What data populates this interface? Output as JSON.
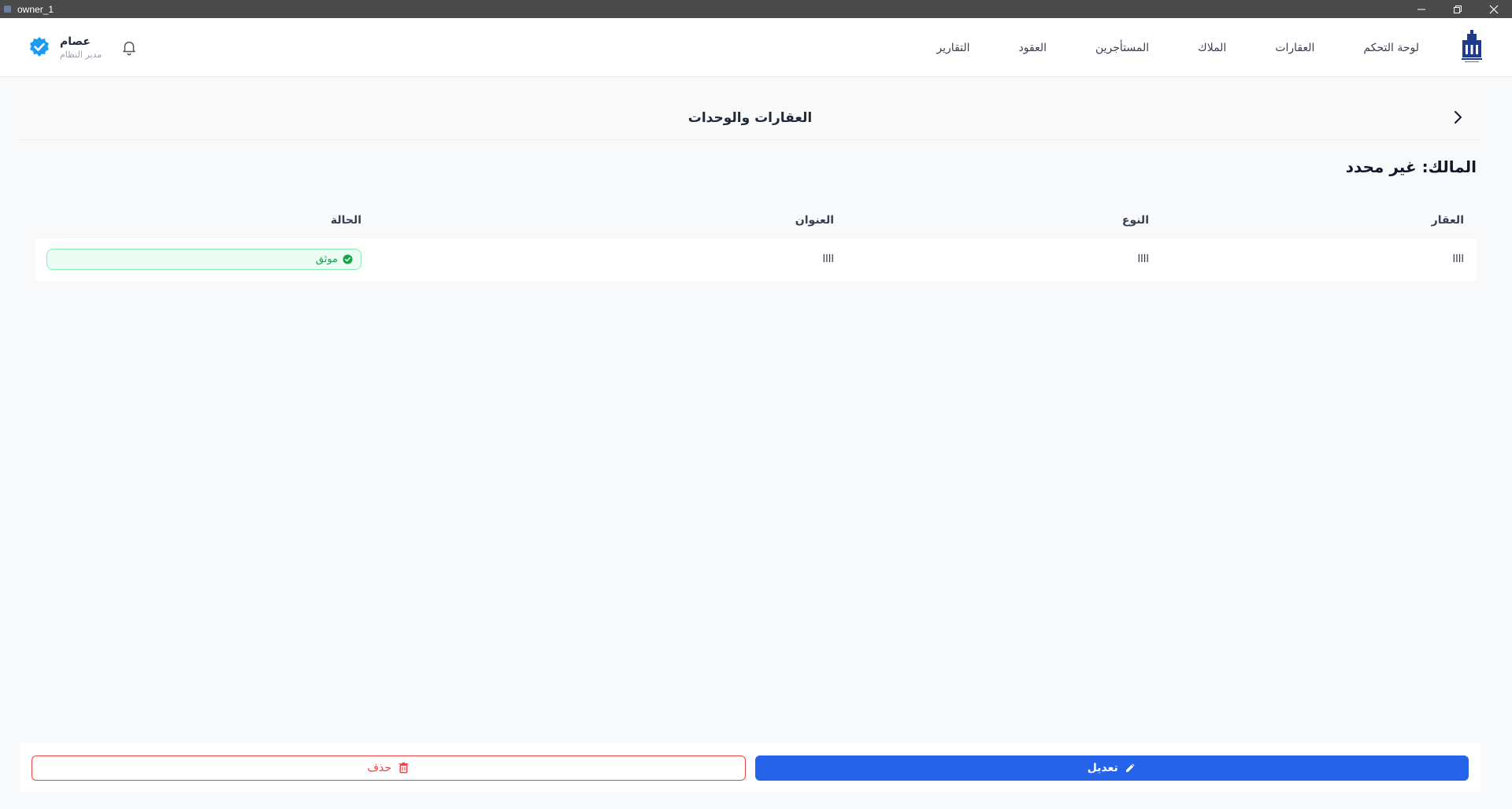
{
  "window": {
    "title": "owner_1"
  },
  "nav": {
    "items": [
      {
        "label": "لوحة التحكم"
      },
      {
        "label": "العقارات"
      },
      {
        "label": "الملاك"
      },
      {
        "label": "المستأجرين"
      },
      {
        "label": "العقود"
      },
      {
        "label": "التقارير"
      }
    ]
  },
  "user": {
    "name": "عصام",
    "role": "مدير النظام"
  },
  "page": {
    "title": "العقارات والوحدات"
  },
  "owner": {
    "heading": "المالك: غير محدد"
  },
  "table": {
    "headers": [
      "العقار",
      "النوع",
      "العنوان",
      "الحالة"
    ],
    "rows": [
      {
        "property": "llll",
        "type": "llll",
        "address": "llll",
        "status": "موثق"
      }
    ]
  },
  "actions": {
    "edit_label": "تعديل",
    "delete_label": "حذف"
  },
  "colors": {
    "primary": "#2563eb",
    "danger": "#ef4444",
    "success": "#16a34a",
    "verified_badge": "#1d9bf0"
  }
}
